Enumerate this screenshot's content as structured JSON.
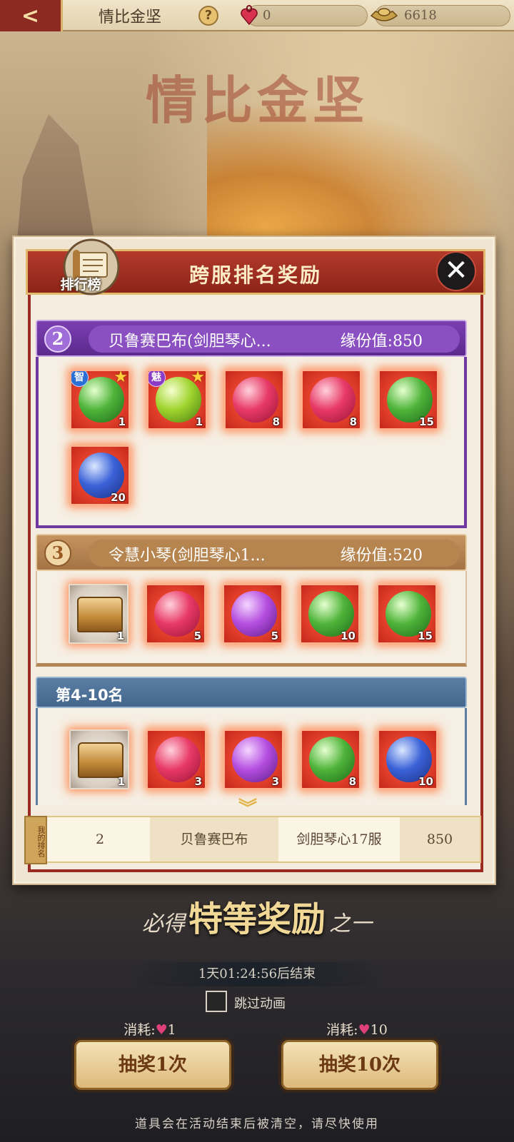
{
  "topbar": {
    "title": "情比金坚",
    "help": "?",
    "hearts": "0",
    "ingots": "6618"
  },
  "banner_title": "情比金坚",
  "panel": {
    "title": "跨服排名奖励",
    "badge_label": "排行榜",
    "close": "✕"
  },
  "tiers": {
    "t2": {
      "rank": "2",
      "name": "贝鲁赛巴布(剑胆琴心...",
      "score": "缘份值:850",
      "items": [
        {
          "icon": "green-pendant",
          "qty": "1",
          "tag": "智"
        },
        {
          "icon": "lime-pendant",
          "qty": "1",
          "tag": "魅"
        },
        {
          "icon": "red-orb",
          "qty": "8"
        },
        {
          "icon": "red-orb",
          "qty": "8"
        },
        {
          "icon": "green-lotus-orb",
          "qty": "15"
        },
        {
          "icon": "blue-orb",
          "qty": "20"
        }
      ]
    },
    "t3": {
      "rank": "3",
      "name": "令慧小琴(剑胆琴心1...",
      "score": "缘份值:520",
      "items": [
        {
          "icon": "treasure-chest",
          "qty": "1"
        },
        {
          "icon": "red-orb",
          "qty": "5"
        },
        {
          "icon": "purple-orb",
          "qty": "5"
        },
        {
          "icon": "green-lotus-orb",
          "qty": "10"
        },
        {
          "icon": "green-lotus-orb",
          "qty": "15"
        }
      ]
    },
    "t4": {
      "title": "第4-10名",
      "items": [
        {
          "icon": "treasure-chest",
          "qty": "1"
        },
        {
          "icon": "red-orb",
          "qty": "3"
        },
        {
          "icon": "purple-orb",
          "qty": "3"
        },
        {
          "icon": "green-lotus-orb",
          "qty": "8"
        },
        {
          "icon": "blue-orb",
          "qty": "10"
        }
      ]
    }
  },
  "my_rank": {
    "tag": "我的排名",
    "rank": "2",
    "name": "贝鲁赛巴布",
    "server": "剑胆琴心17服",
    "score": "850"
  },
  "bottom": {
    "special_a": "必得",
    "special_b": "特等奖励",
    "special_c": "之一",
    "timer": "1天01:24:56后结束",
    "skip_label": "跳过动画",
    "cost_label": "消耗:",
    "cost1": "1",
    "cost10": "10",
    "draw1": "抽奖1次",
    "draw10": "抽奖10次",
    "footer": "道具会在活动结束后被清空，请尽快使用"
  }
}
